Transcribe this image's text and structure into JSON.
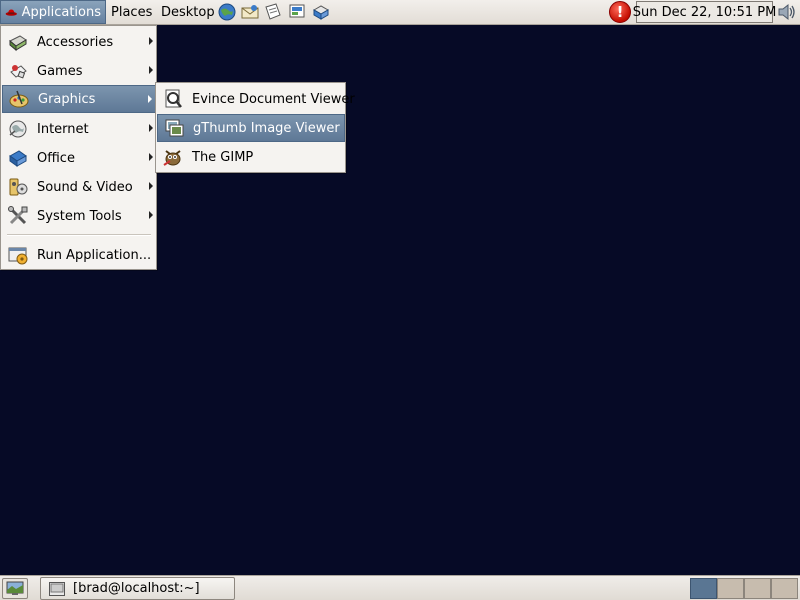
{
  "top_panel": {
    "menus": {
      "applications": "Applications",
      "places": "Places",
      "desktop": "Desktop"
    },
    "launchers": [
      "web-browser-icon",
      "email-icon",
      "word-processor-icon",
      "presentation-icon",
      "spreadsheet-icon"
    ],
    "clock": "Sun Dec 22, 10:51 PM",
    "update_notifier": "!"
  },
  "applications_menu": {
    "items": [
      {
        "label": "Accessories",
        "icon": "accessories-icon",
        "submenu": true
      },
      {
        "label": "Games",
        "icon": "games-icon",
        "submenu": true
      },
      {
        "label": "Graphics",
        "icon": "graphics-icon",
        "submenu": true,
        "selected": true
      },
      {
        "label": "Internet",
        "icon": "internet-icon",
        "submenu": true
      },
      {
        "label": "Office",
        "icon": "office-icon",
        "submenu": true
      },
      {
        "label": "Sound & Video",
        "icon": "sound-video-icon",
        "submenu": true
      },
      {
        "label": "System Tools",
        "icon": "system-tools-icon",
        "submenu": true
      },
      {
        "label": "Run Application...",
        "icon": "run-application-icon",
        "submenu": false
      }
    ]
  },
  "graphics_submenu": {
    "items": [
      {
        "label": "Evince Document Viewer",
        "icon": "evince-icon"
      },
      {
        "label": "gThumb Image Viewer",
        "icon": "gthumb-icon",
        "selected": true
      },
      {
        "label": "The GIMP",
        "icon": "gimp-icon"
      }
    ]
  },
  "bottom_panel": {
    "task": "[brad@localhost:~]",
    "workspaces": 4,
    "active_workspace": 1
  },
  "colors": {
    "desktop_background": "#060a26",
    "selection": "#6681a0",
    "panel": "#e8e4de"
  }
}
